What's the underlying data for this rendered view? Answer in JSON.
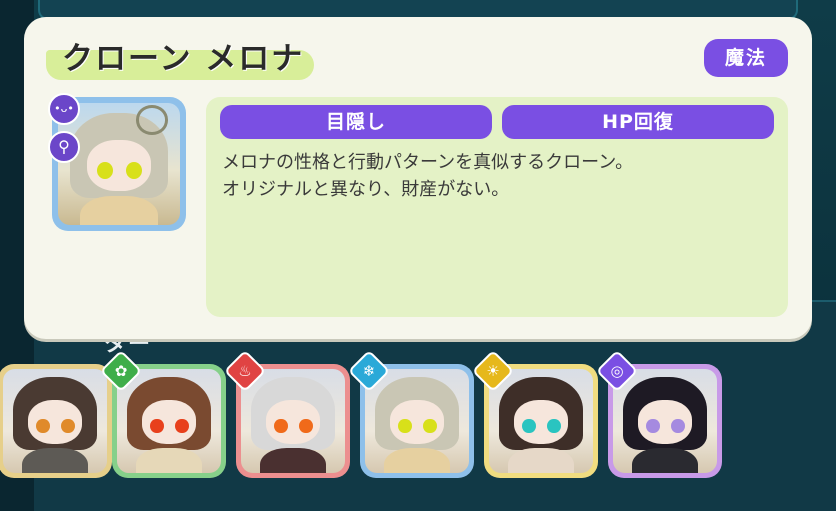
{
  "character": {
    "name": "クローン メロナ",
    "type_label": "魔法",
    "skills": [
      "目隠し",
      "HP回復"
    ],
    "description": "メロナの性格と行動パターンを真似するクローン。\nオリジナルと異なり、財産がない。"
  },
  "badges": [
    {
      "icon": "devil-face-icon",
      "glyph": "•ᴗ•"
    },
    {
      "icon": "key-icon",
      "glyph": "⚲"
    }
  ],
  "background_label": "ター",
  "roster": [
    {
      "name": "tile-1",
      "frame": "#e6cf8a",
      "elem": null,
      "hair": "#4a3a32",
      "eye": "#e08a2a",
      "body": "#5d5a55"
    },
    {
      "name": "tile-2",
      "frame": "#86d08a",
      "elem": {
        "icon": "leaf-icon",
        "color": "#3fae4a",
        "glyph": "✿"
      },
      "hair": "#7a4a30",
      "eye": "#e8401c",
      "body": "#e6d8b8"
    },
    {
      "name": "tile-3",
      "frame": "#ec8f8f",
      "elem": {
        "icon": "fire-icon",
        "color": "#e04343",
        "glyph": "♨"
      },
      "hair": "#d8d8d8",
      "eye": "#f06a1a",
      "body": "#4a3030"
    },
    {
      "name": "tile-4",
      "frame": "#8ec0ea",
      "elem": {
        "icon": "snowflake-icon",
        "color": "#2aa9d8",
        "glyph": "❄"
      },
      "hair": "#c9c6b4",
      "eye": "#d8e01a",
      "body": "#e6d0a0"
    },
    {
      "name": "tile-5",
      "frame": "#f0dc80",
      "elem": {
        "icon": "sun-icon",
        "color": "#e6b81c",
        "glyph": "☀"
      },
      "hair": "#3e2e28",
      "eye": "#2ac4c0",
      "body": "#e6d8c8"
    },
    {
      "name": "tile-6",
      "frame": "#c89ae8",
      "elem": {
        "icon": "vortex-icon",
        "color": "#7a4fe3",
        "glyph": "◎"
      },
      "hair": "#1e1a24",
      "eye": "#a58ae0",
      "body": "#2a2a30"
    }
  ]
}
